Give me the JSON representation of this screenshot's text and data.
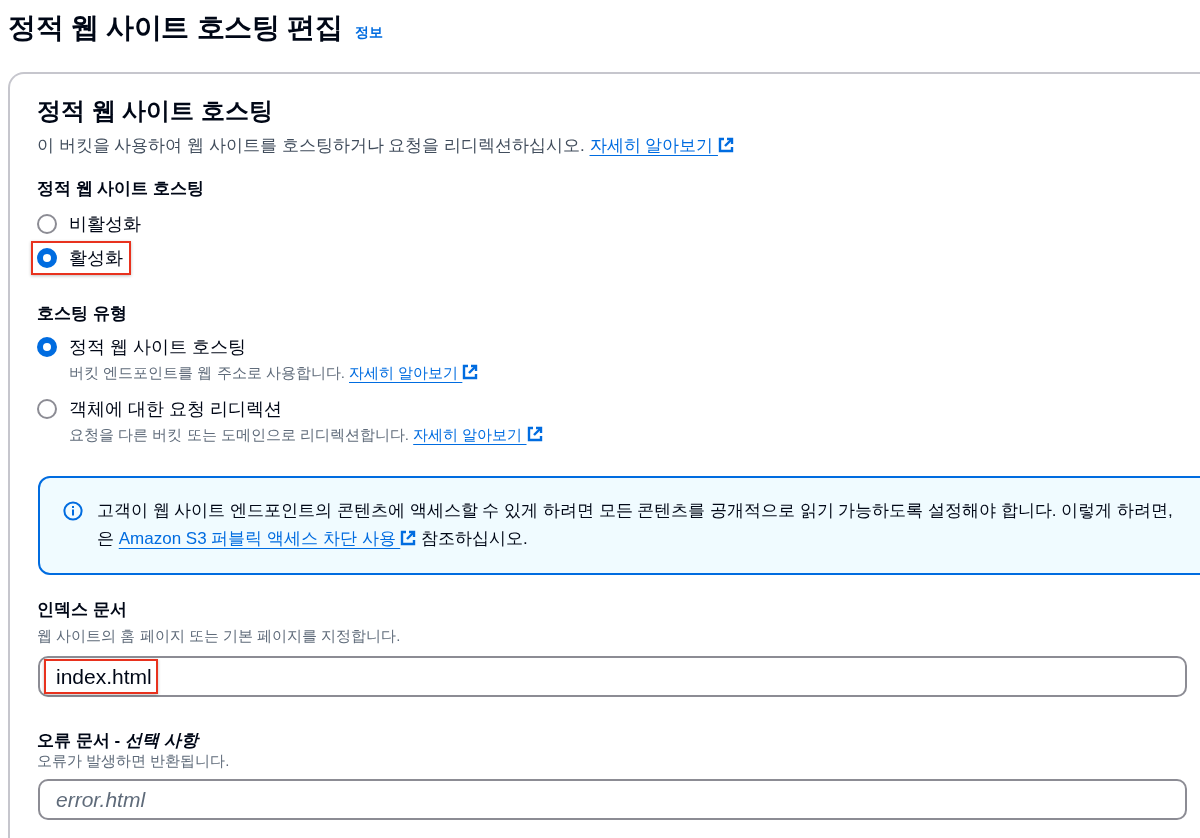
{
  "page": {
    "title": "정적 웹 사이트 호스팅 편집",
    "info_link": "정보"
  },
  "panel": {
    "title": "정적 웹 사이트 호스팅",
    "description": "이 버킷을 사용하여 웹 사이트를 호스팅하거나 요청을 리디렉션하십시오.",
    "learn_more": "자세히 알아보기"
  },
  "hosting_toggle": {
    "label": "정적 웹 사이트 호스팅",
    "options": [
      {
        "label": "비활성화",
        "selected": false,
        "highlighted": false
      },
      {
        "label": "활성화",
        "selected": true,
        "highlighted": true
      }
    ]
  },
  "hosting_type": {
    "label": "호스팅 유형",
    "options": [
      {
        "label": "정적 웹 사이트 호스팅",
        "description": "버킷 엔드포인트를 웹 주소로 사용합니다.",
        "learn_more": "자세히 알아보기",
        "selected": true
      },
      {
        "label": "객체에 대한 요청 리디렉션",
        "description": "요청을 다른 버킷 또는 도메인으로 리디렉션합니다.",
        "learn_more": "자세히 알아보기",
        "selected": false
      }
    ]
  },
  "alert": {
    "kind": "info",
    "line_1": "고객이 웹 사이트 엔드포인트의 콘텐츠에 액세스할 수 있게 하려면 모든 콘텐츠를 공개적으로 읽기 가능하도록 설정해야 합니다. 이렇게 하려면,",
    "line_2_start": "은",
    "link": "Amazon S3 퍼블릭 액세스 차단 사용",
    "line_2_end": "참조하십시오."
  },
  "index_document": {
    "label": "인덱스 문서",
    "description": "웹 사이트의 홈 페이지 또는 기본 페이지를 지정합니다.",
    "value": "index.html",
    "highlighted": true
  },
  "error_document": {
    "label": "오류 문서 - *선택 사항*",
    "description": "오류가 발생하면 반환됩니다.",
    "placeholder": "error.html"
  }
}
